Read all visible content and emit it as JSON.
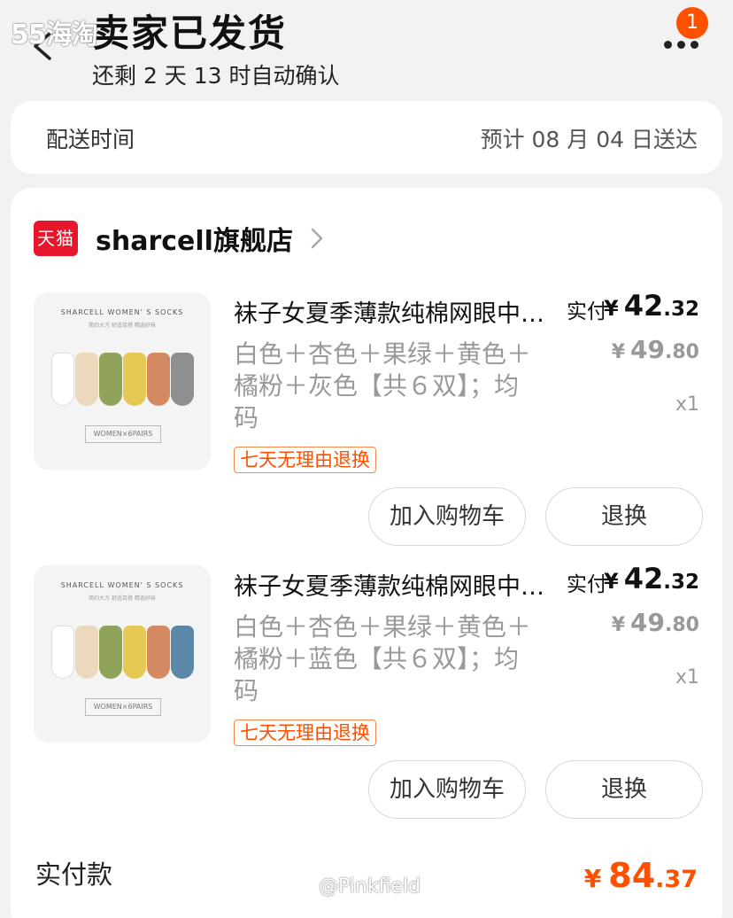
{
  "watermark_top": "55海淘",
  "header": {
    "title": "卖家已发货",
    "subtitle": "还剩 2 天 13 时自动确认",
    "notification_count": "1"
  },
  "delivery": {
    "label": "配送时间",
    "value": "预计 08 月 04 日送达"
  },
  "shop": {
    "logo_text": "天猫",
    "name": "sharcell旗舰店"
  },
  "products": [
    {
      "image_title": "SHARCELL WOMEN' S SOCKS",
      "image_subtitle": "简约大方 舒适百搭 精选好袜",
      "image_footer": "WOMEN×6PAIRS",
      "sock_colors": [
        "#ffffff",
        "#ecd9bd",
        "#8fa45a",
        "#e6c955",
        "#d38a62",
        "#8f8f8f"
      ],
      "title": "袜子女夏季薄款纯棉网眼中筒袜",
      "spec": "白色＋杏色＋果绿＋黄色＋橘粉＋灰色【共６双】；均码",
      "tag": "七天无理由退换",
      "paid_label": "实付",
      "paid_symbol": "¥",
      "paid_int": "42",
      "paid_dec": ".32",
      "orig_symbol": "¥",
      "orig_int": "49",
      "orig_dec": ".80",
      "quantity": "x1",
      "cart_button": "加入购物车",
      "return_button": "退换"
    },
    {
      "image_title": "SHARCELL WOMEN' S SOCKS",
      "image_subtitle": "简约大方 舒适百搭 精选好袜",
      "image_footer": "WOMEN×6PAIRS",
      "sock_colors": [
        "#ffffff",
        "#ecd9bd",
        "#8fa45a",
        "#e6c955",
        "#d38a62",
        "#5b88a6"
      ],
      "title": "袜子女夏季薄款纯棉网眼中筒袜",
      "spec": "白色＋杏色＋果绿＋黄色＋橘粉＋蓝色【共６双】；均码",
      "tag": "七天无理由退换",
      "paid_label": "实付",
      "paid_symbol": "¥",
      "paid_int": "42",
      "paid_dec": ".32",
      "orig_symbol": "¥",
      "orig_int": "49",
      "orig_dec": ".80",
      "quantity": "x1",
      "cart_button": "加入购物车",
      "return_button": "退换"
    }
  ],
  "total": {
    "label": "实付款",
    "symbol": "¥",
    "int": "84",
    "dec": ".37"
  },
  "watermark_bottom": "@Pinkfield",
  "colors": {
    "accent": "#ff5000",
    "tmall_red": "#e8162c",
    "background": "#f2f2f2"
  }
}
